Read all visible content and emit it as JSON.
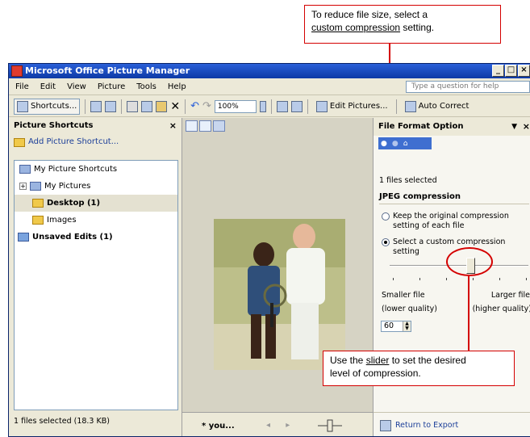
{
  "callouts": {
    "top_line1": "To reduce file size, select a",
    "top_link": "custom compression",
    "top_line2_rest": " setting.",
    "bottom_pre": "Use the ",
    "bottom_link": "slider",
    "bottom_post": " to set the desired",
    "bottom_line2": "level of compression."
  },
  "window": {
    "title": "Microsoft Office Picture Manager",
    "controls": [
      "_",
      "□",
      "×"
    ]
  },
  "menu": {
    "items": [
      "File",
      "Edit",
      "View",
      "Picture",
      "Tools",
      "Help"
    ],
    "help_placeholder": "Type a question for help"
  },
  "toolbar": {
    "shortcuts_label": "Shortcuts...",
    "zoom_value": "100%",
    "edit_pictures_label": "Edit Pictures...",
    "auto_correct_label": "Auto Correct"
  },
  "left_pane": {
    "title": "Picture Shortcuts",
    "close": "×",
    "add_shortcut": "Add Picture Shortcut...",
    "tree": [
      {
        "label": "My Picture Shortcuts"
      },
      {
        "label": "My Pictures",
        "expander": "+"
      },
      {
        "label": "Desktop (1)"
      },
      {
        "label": "Images"
      },
      {
        "label": "Unsaved Edits (1)"
      }
    ],
    "status": "1 files selected (18.3 KB)"
  },
  "center_pane": {
    "film_label": "* you...",
    "nav_arrows": "◂ ▸"
  },
  "right_pane": {
    "title": "File Format Option",
    "dropdown": "▼",
    "close": "×",
    "files_selected": "1 files selected",
    "jpeg_heading": "JPEG compression",
    "option_keep": "Keep the original compression setting of each file",
    "option_custom": "Select a custom compression setting",
    "selected_option": "custom",
    "smaller_file": "Smaller file",
    "lower_quality": "(lower quality)",
    "larger_file": "Larger file",
    "higher_quality": "(higher quality)",
    "compression_value": "60",
    "return_link": "Return to Export"
  },
  "colors": {
    "callout_border": "#d40000",
    "title_bar": "#0d3aa6",
    "link": "#1c3f99"
  }
}
